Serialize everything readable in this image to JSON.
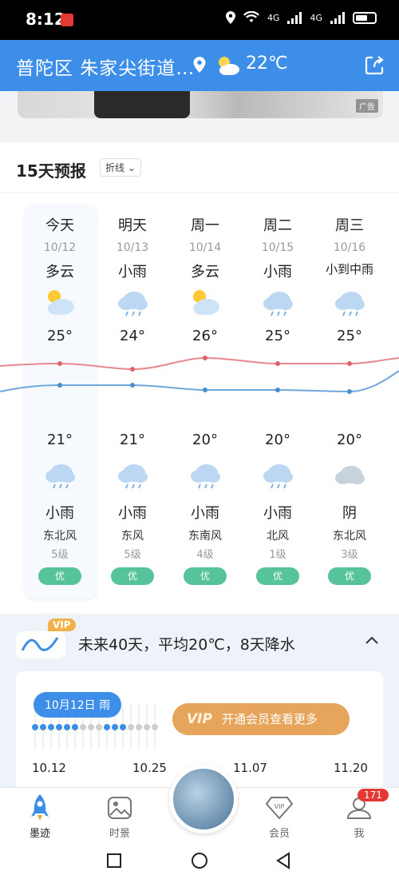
{
  "status_bar": {
    "time": "8:12",
    "network1": "4G",
    "network2": "4G"
  },
  "header": {
    "location": "普陀区 朱家尖街道…",
    "temperature": "22℃"
  },
  "ad": {
    "tag": "广告"
  },
  "forecast": {
    "title": "15天预报",
    "mode": "折线",
    "days": [
      {
        "name": "今天",
        "date": "10/12",
        "day_cond": "多云",
        "day_icon": "partly-cloudy-icon",
        "high": "25°",
        "low": "21°",
        "night_icon": "rain-cloud-icon",
        "night_cond": "小雨",
        "wind": "东北风",
        "wind_level": "5级",
        "aqi": "优"
      },
      {
        "name": "明天",
        "date": "10/13",
        "day_cond": "小雨",
        "day_icon": "rain-cloud-icon",
        "high": "24°",
        "low": "21°",
        "night_icon": "rain-cloud-icon",
        "night_cond": "小雨",
        "wind": "东风",
        "wind_level": "5级",
        "aqi": "优"
      },
      {
        "name": "周一",
        "date": "10/14",
        "day_cond": "多云",
        "day_icon": "partly-cloudy-icon",
        "high": "26°",
        "low": "20°",
        "night_icon": "rain-cloud-icon",
        "night_cond": "小雨",
        "wind": "东南风",
        "wind_level": "4级",
        "aqi": "优"
      },
      {
        "name": "周二",
        "date": "10/15",
        "day_cond": "小雨",
        "day_icon": "rain-cloud-icon",
        "high": "25°",
        "low": "20°",
        "night_icon": "rain-cloud-icon",
        "night_cond": "小雨",
        "wind": "北风",
        "wind_level": "1级",
        "aqi": "优"
      },
      {
        "name": "周三",
        "date": "10/16",
        "day_cond": "小到中雨",
        "day_icon": "rain-cloud-icon",
        "high": "25°",
        "low": "20°",
        "night_icon": "overcast-cloud-icon",
        "night_cond": "阴",
        "wind": "东北风",
        "wind_level": "3级",
        "aqi": "优"
      }
    ]
  },
  "forty_day": {
    "vip_badge": "VIP",
    "summary": "未来40天，平均20℃，8天降水",
    "date_chip": "10月12日 雨",
    "vip_mark": "VIP",
    "vip_button": "开通会员查看更多",
    "x_labels": [
      "10.12",
      "10.25",
      "11.07",
      "11.20"
    ]
  },
  "tabs": [
    {
      "label": "墨迹",
      "icon": "rocket-icon",
      "active": true
    },
    {
      "label": "时景",
      "icon": "picture-icon",
      "active": false
    },
    {
      "label": "会员",
      "icon": "vip-diamond-icon",
      "active": false
    },
    {
      "label": "我",
      "icon": "profile-icon",
      "active": false
    }
  ],
  "profile_badge": "171",
  "colors": {
    "header_blue": "#3d8ee8",
    "aqi_green": "#56c39a",
    "high_line": "#e8888c",
    "low_line": "#6fa8dc",
    "vip_gold": "#e6a55a"
  }
}
